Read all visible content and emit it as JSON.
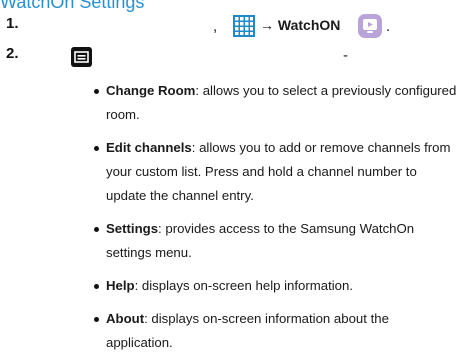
{
  "heading": "WatchOn Settings",
  "steps": [
    {
      "num": "1.",
      "comma": ",",
      "arrow_text": "→ WatchON",
      "period": "."
    },
    {
      "num": "2.",
      "dash": "-"
    }
  ],
  "icons": {
    "apps": "apps-grid-icon",
    "watchon": "watchon-app-icon",
    "menu": "menu-key-icon"
  },
  "colors": {
    "heading": "#2a8fd0",
    "apps_icon": "#1e88c8",
    "watchon_icon": "#b8a4d8"
  },
  "options": [
    {
      "term": "Change Room",
      "desc": ": allows you to select a previously configured room."
    },
    {
      "term": "Edit channels",
      "desc": ": allows you to add or remove channels from your custom list. Press and hold a channel number to update the channel entry."
    },
    {
      "term": "Settings",
      "desc": ": provides access to the Samsung WatchOn settings menu."
    },
    {
      "term": "Help",
      "desc": ": displays on-screen help information."
    },
    {
      "term": "About",
      "desc": ": displays on-screen information about the application."
    }
  ]
}
